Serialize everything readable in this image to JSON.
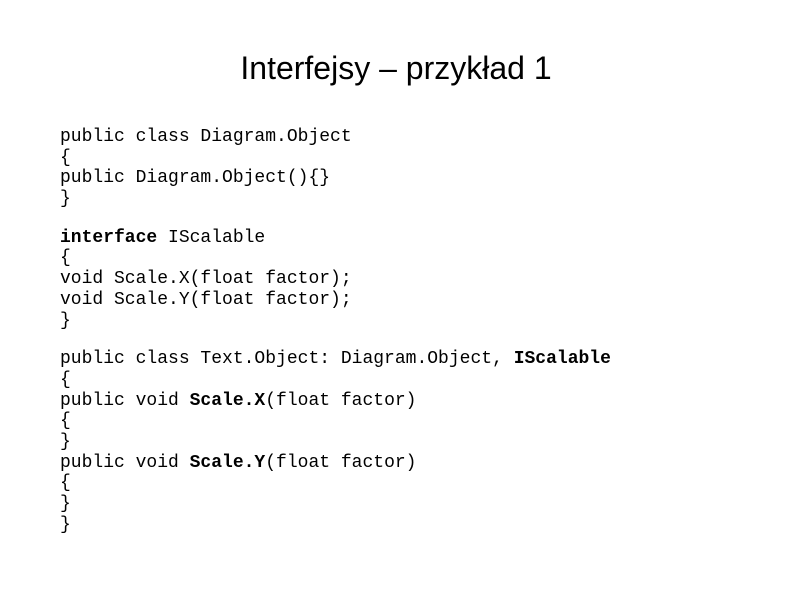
{
  "title": "Interfejsy – przykład 1",
  "code": {
    "block1": {
      "l1": "public class Diagram.Object",
      "l2": "{",
      "l3": "public Diagram.Object(){}",
      "l4": "}"
    },
    "block2": {
      "l1a": "interface",
      "l1b": " IScalable",
      "l2": "{",
      "l3": "void Scale.X(float factor);",
      "l4": "void Scale.Y(float factor);",
      "l5": "}"
    },
    "block3": {
      "l1a": "public class Text.Object: Diagram.Object, ",
      "l1b": "IScalable",
      "l2": "{",
      "l3a": "public void ",
      "l3b": "Scale.X",
      "l3c": "(float factor)",
      "l4": "{",
      "l5": "}",
      "l6a": "public void ",
      "l6b": "Scale.Y",
      "l6c": "(float factor)",
      "l7": "{",
      "l8": "}",
      "l9": "}"
    }
  }
}
